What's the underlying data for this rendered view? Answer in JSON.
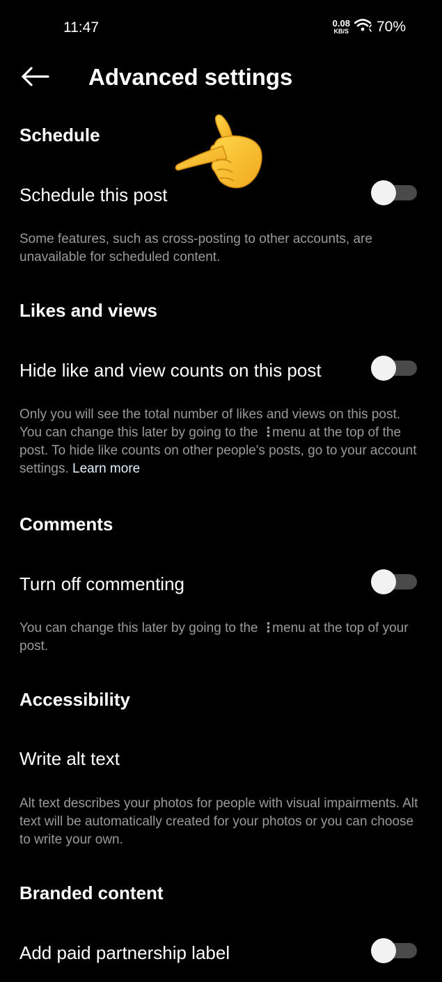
{
  "status_bar": {
    "time": "11:47",
    "net_speed_value": "0.08",
    "net_speed_unit": "KB/S",
    "battery": "70%",
    "icons": [
      "wifi-icon"
    ]
  },
  "header": {
    "back_icon": "arrow-left-icon",
    "title": "Advanced settings"
  },
  "sections": {
    "schedule": {
      "heading": "Schedule",
      "toggle_label": "Schedule this post",
      "toggle_on": false,
      "description": "Some features, such as cross-posting to other accounts, are unavailable for scheduled content."
    },
    "likes_views": {
      "heading": "Likes and views",
      "toggle_label": "Hide like and view counts on this post",
      "toggle_on": false,
      "description_part1": "Only you will see the total number of likes and views on this post. You can change this later by going to the",
      "menu_glyph": "⋮",
      "description_part2": "menu at the top of the post. To hide like counts on other people's posts, go to your account settings.",
      "link": "Learn more"
    },
    "comments": {
      "heading": "Comments",
      "toggle_label": "Turn off commenting",
      "toggle_on": false,
      "description_part1": "You can change this later by going to the",
      "menu_glyph": "⋮",
      "description_part2": "menu at the top of your post."
    },
    "accessibility": {
      "heading": "Accessibility",
      "row_label": "Write alt text",
      "description": "Alt text describes your photos for people with visual impairments. Alt text will be automatically created for your photos or you can choose to write your own."
    },
    "branded": {
      "heading": "Branded content",
      "toggle_label": "Add paid partnership label",
      "toggle_on": false
    }
  },
  "colors": {
    "background": "#000000",
    "text_primary": "#ffffff",
    "text_secondary": "#9a9a9a",
    "link": "#e0f1ff",
    "toggle_track": "#4a4a4a",
    "toggle_knob": "#f2f2f2"
  },
  "overlay": {
    "icon": "pointing-hand-emoji-icon"
  }
}
